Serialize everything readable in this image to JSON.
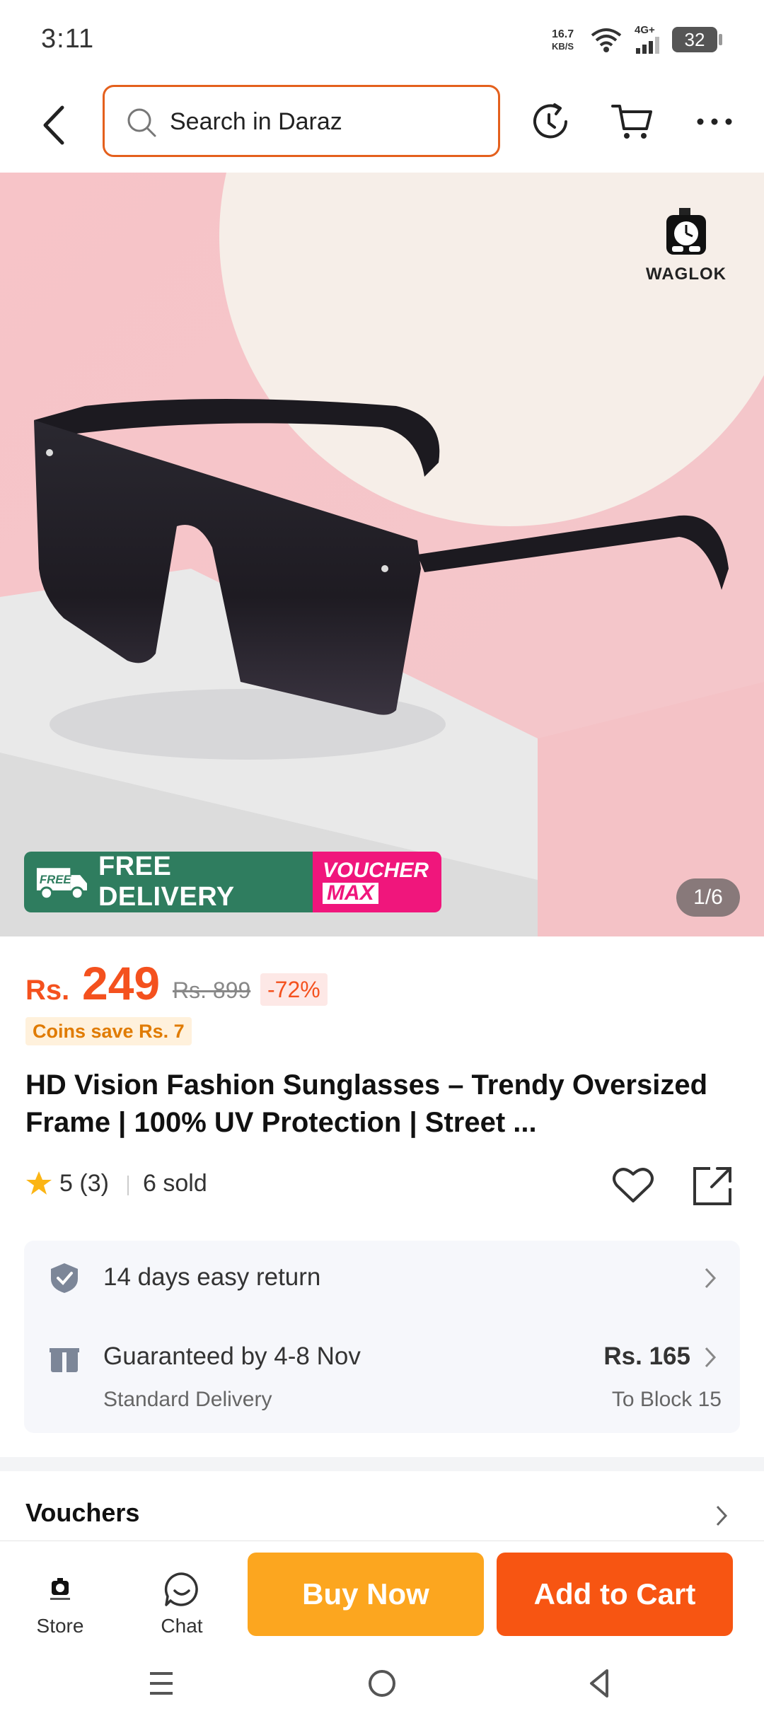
{
  "status_bar": {
    "time": "3:11",
    "speed_value": "16.7",
    "speed_unit": "KB/S",
    "network": "4G+",
    "battery": "32"
  },
  "header": {
    "search_placeholder": "Search in Daraz",
    "icons": [
      "back-icon",
      "search-icon",
      "history-icon",
      "cart-icon",
      "more-icon"
    ]
  },
  "hero": {
    "brand": "WAGLOK",
    "promo_free_badge": "FREE",
    "promo_free_delivery": "FREE DELIVERY",
    "promo_voucher_line1": "VOUCHER",
    "promo_voucher_line2": "MAX",
    "page_indicator": "1/6",
    "colors": {
      "background": "#f6c9cc",
      "podium": "#eeeeee",
      "lens": "#1f1c22"
    }
  },
  "price": {
    "currency": "Rs.",
    "current": "249",
    "original": "Rs. 899",
    "discount": "-72%",
    "coins": "Coins save Rs. 7"
  },
  "product": {
    "title": "HD Vision Fashion Sunglasses – Trendy Oversized Frame | 100% UV Protection | Street ..."
  },
  "rating": {
    "score": "5",
    "count": "(3)",
    "sold": "6 sold"
  },
  "services": {
    "return_label": "14 days easy return",
    "delivery_label": "Guaranteed by 4-8 Nov",
    "delivery_type": "Standard Delivery",
    "delivery_price": "Rs. 165",
    "delivery_location": "To Block 15"
  },
  "vouchers": {
    "title": "Vouchers"
  },
  "bottom_bar": {
    "store_label": "Store",
    "chat_label": "Chat",
    "buy_now": "Buy Now",
    "add_to_cart": "Add to Cart"
  },
  "colors": {
    "accent": "#f4511e",
    "buy_now": "#fca61f",
    "add_to_cart": "#f75512",
    "search_border": "#e4601d",
    "free_delivery": "#2f7d5f",
    "voucher": "#f0167c"
  }
}
